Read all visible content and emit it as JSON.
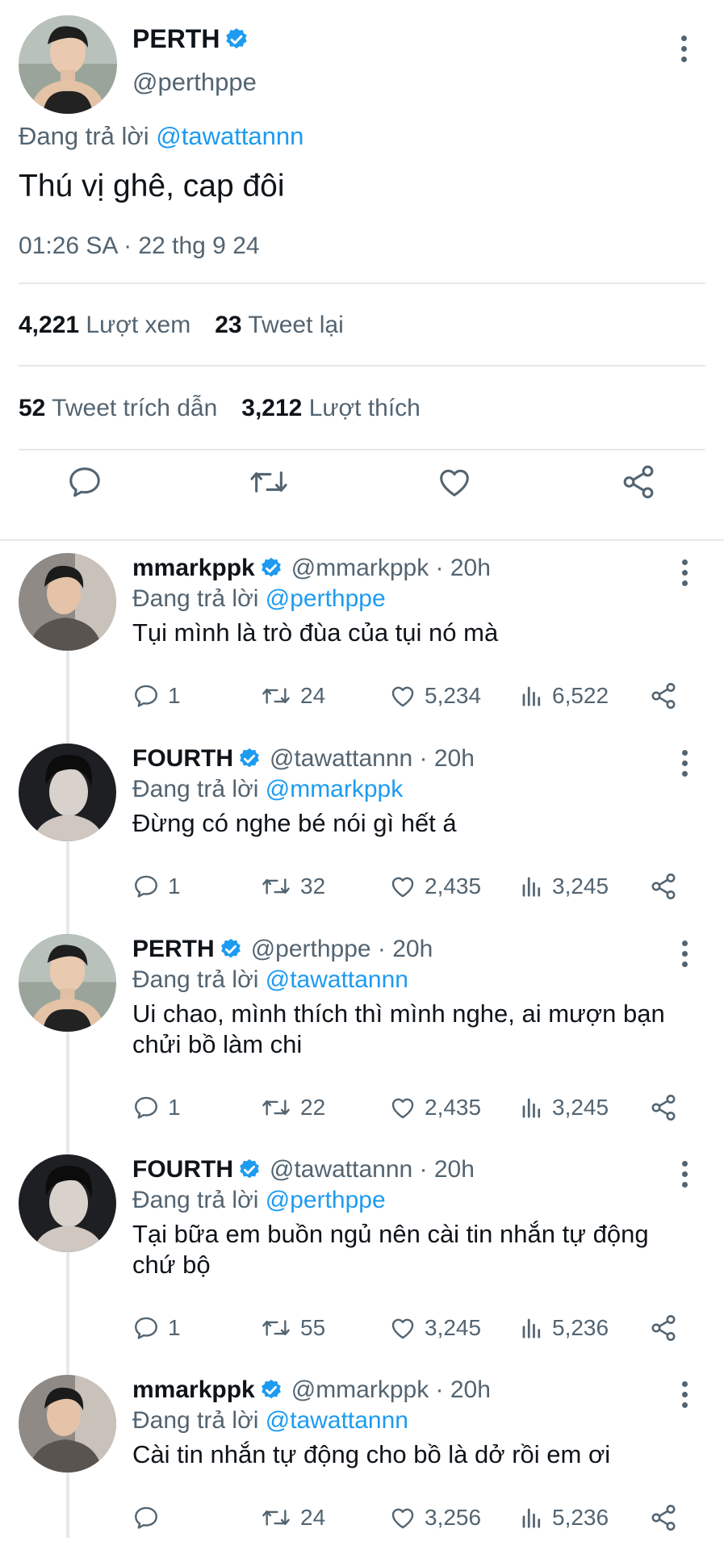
{
  "main_tweet": {
    "name": "PERTH",
    "handle": "@perthppe",
    "reply_prefix": "Đang trả lời",
    "reply_to": "@tawattannn",
    "text": "Thú vị ghê, cap đôi",
    "timestamp": "01:26 SA · 22 thg 9 24",
    "stats": {
      "views_count": "4,221",
      "views_label": "Lượt xem",
      "retweets_count": "23",
      "retweets_label": "Tweet lại",
      "quotes_count": "52",
      "quotes_label": "Tweet trích dẫn",
      "likes_count": "3,212",
      "likes_label": "Lượt thích"
    }
  },
  "replies": [
    {
      "name": "mmarkppk",
      "meta": "@mmarkppk · 20h",
      "reply_prefix": "Đang trả lời",
      "reply_to": "@perthppe",
      "text": "Tụi mình là trò đùa của tụi nó mà",
      "replies": "1",
      "retweets": "24",
      "likes": "5,234",
      "views": "6,522"
    },
    {
      "name": "FOURTH",
      "meta": "@tawattannn · 20h",
      "reply_prefix": "Đang trả lời",
      "reply_to": "@mmarkppk",
      "text": "Đừng có nghe bé nói gì hết á",
      "replies": "1",
      "retweets": "32",
      "likes": "2,435",
      "views": "3,245"
    },
    {
      "name": "PERTH",
      "meta": "@perthppe · 20h",
      "reply_prefix": "Đang trả lời",
      "reply_to": "@tawattannn",
      "text": "Ui chao, mình thích thì mình nghe, ai mượn bạn chửi bồ làm chi",
      "replies": "1",
      "retweets": "22",
      "likes": "2,435",
      "views": "3,245"
    },
    {
      "name": "FOURTH",
      "meta": "@tawattannn · 20h",
      "reply_prefix": "Đang trả lời",
      "reply_to": "@perthppe",
      "text": "Tại bữa em buồn ngủ nên cài tin nhắn tự động chứ bộ",
      "replies": "1",
      "retweets": "55",
      "likes": "3,245",
      "views": "5,236"
    },
    {
      "name": "mmarkppk",
      "meta": "@mmarkppk · 20h",
      "reply_prefix": "Đang trả lời",
      "reply_to": "@tawattannn",
      "text": "Cài tin nhắn tự động cho bồ là dở rồi em ơi",
      "replies": "",
      "retweets": "24",
      "likes": "3,256",
      "views": "5,236"
    }
  ],
  "colors": {
    "link": "#1d9bf0",
    "secondary": "#536471",
    "verified": "#1d9bf0",
    "divider": "#e6e9eb"
  },
  "icons": [
    "verified-badge-icon",
    "more-icon",
    "reply-icon",
    "retweet-icon",
    "like-icon",
    "share-icon",
    "views-icon"
  ]
}
